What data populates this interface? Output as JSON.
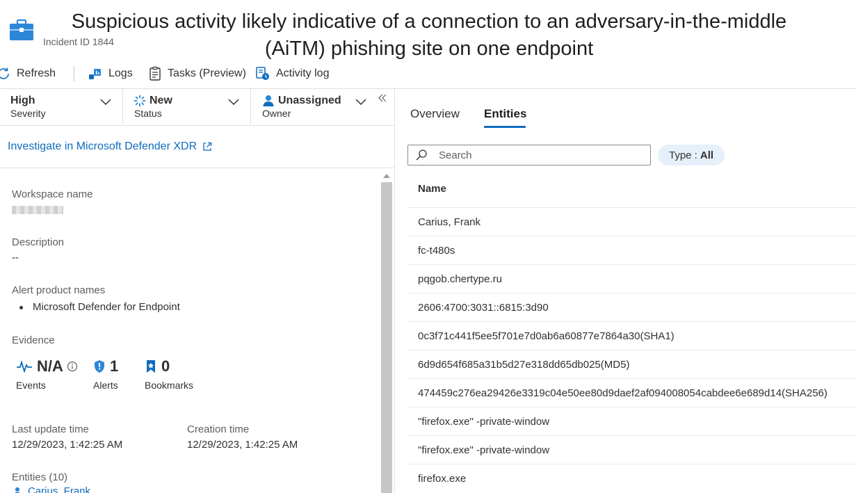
{
  "header": {
    "title": "Suspicious activity likely indicative of a connection to an adversary-in-the-middle (AiTM) phishing site on one endpoint",
    "incident_id": "Incident ID 1844"
  },
  "toolbar": {
    "refresh": "Refresh",
    "logs": "Logs",
    "tasks": "Tasks (Preview)",
    "activity_log": "Activity log"
  },
  "dropdowns": {
    "severity": {
      "value": "High",
      "label": "Severity"
    },
    "status": {
      "value": "New",
      "label": "Status"
    },
    "owner": {
      "value": "Unassigned",
      "label": "Owner"
    }
  },
  "investigate_link": "Investigate in Microsoft Defender XDR",
  "details": {
    "workspace_label": "Workspace name",
    "description_label": "Description",
    "description_value": "--",
    "alert_products_label": "Alert product names",
    "alert_products": [
      "Microsoft Defender for Endpoint"
    ],
    "evidence_label": "Evidence",
    "evidence": {
      "events": {
        "value": "N/A",
        "label": "Events"
      },
      "alerts": {
        "value": "1",
        "label": "Alerts"
      },
      "bookmarks": {
        "value": "0",
        "label": "Bookmarks"
      }
    },
    "last_update_label": "Last update time",
    "last_update_value": "12/29/2023, 1:42:25 AM",
    "creation_label": "Creation time",
    "creation_value": "12/29/2023, 1:42:25 AM",
    "entities_label": "Entities (10)",
    "entities_first": "Carius, Frank"
  },
  "tabs": {
    "overview": "Overview",
    "entities": "Entities"
  },
  "search": {
    "placeholder": "Search"
  },
  "type_filter": {
    "label": "Type :",
    "value": "All"
  },
  "table": {
    "column": "Name",
    "rows": [
      "Carius, Frank",
      "fc-t480s",
      "pqgob.chertype.ru",
      "2606:4700:3031::6815:3d90",
      "0c3f71c441f5ee5f701e7d0ab6a60877e7864a30(SHA1)",
      "6d9d654f685a31b5d27e318dd65db025(MD5)",
      "474459c276ea29426e3319c04e50ee80d9daef2af094008054cabdee6e689d14(SHA256)",
      "\"firefox.exe\" -private-window",
      "\"firefox.exe\" -private-window",
      "firefox.exe"
    ]
  },
  "colors": {
    "accent": "#0f6cbd",
    "pill_bg": "#e6f0fa",
    "border": "#e1dfdd"
  }
}
